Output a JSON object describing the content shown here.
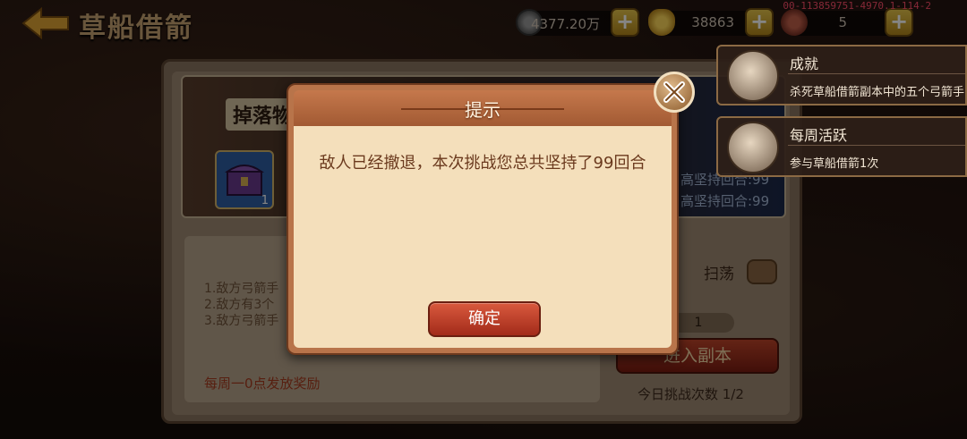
{
  "header": {
    "title": "草船借箭",
    "debug_id": "00-113859751-4970.1-114-2"
  },
  "resources": [
    {
      "name": "copper",
      "icon": "coin-icon",
      "value": "4377.20万"
    },
    {
      "name": "gold",
      "icon": "gold-ingot-icon",
      "value": "38863"
    },
    {
      "name": "stamina",
      "icon": "meat-icon",
      "value": "5"
    }
  ],
  "panel": {
    "drop_title": "掉落物",
    "chest_count": "1",
    "best_rounds": [
      "高坚持回合:99",
      "高坚持回合:99"
    ],
    "rules": [
      "1.敌方弓箭手",
      "2.敌方有3个",
      "3.敌方弓箭手"
    ],
    "weekly_note": "每周一0点发放奖励",
    "sweep_label": "扫荡",
    "quantity": "1",
    "enter_button": "进入副本",
    "today_count": "今日挑战次数 1/2"
  },
  "modal": {
    "title": "提示",
    "message": "敌人已经撤退，本次挑战您总共坚持了99回合",
    "confirm_button": "确定"
  },
  "toasts": [
    {
      "title": "成就",
      "desc": "杀死草船借箭副本中的五个弓箭手",
      "icon": "scroll-icon"
    },
    {
      "title": "每周活跃",
      "desc": "参与草船借箭1次",
      "icon": "scroll-icon"
    }
  ]
}
